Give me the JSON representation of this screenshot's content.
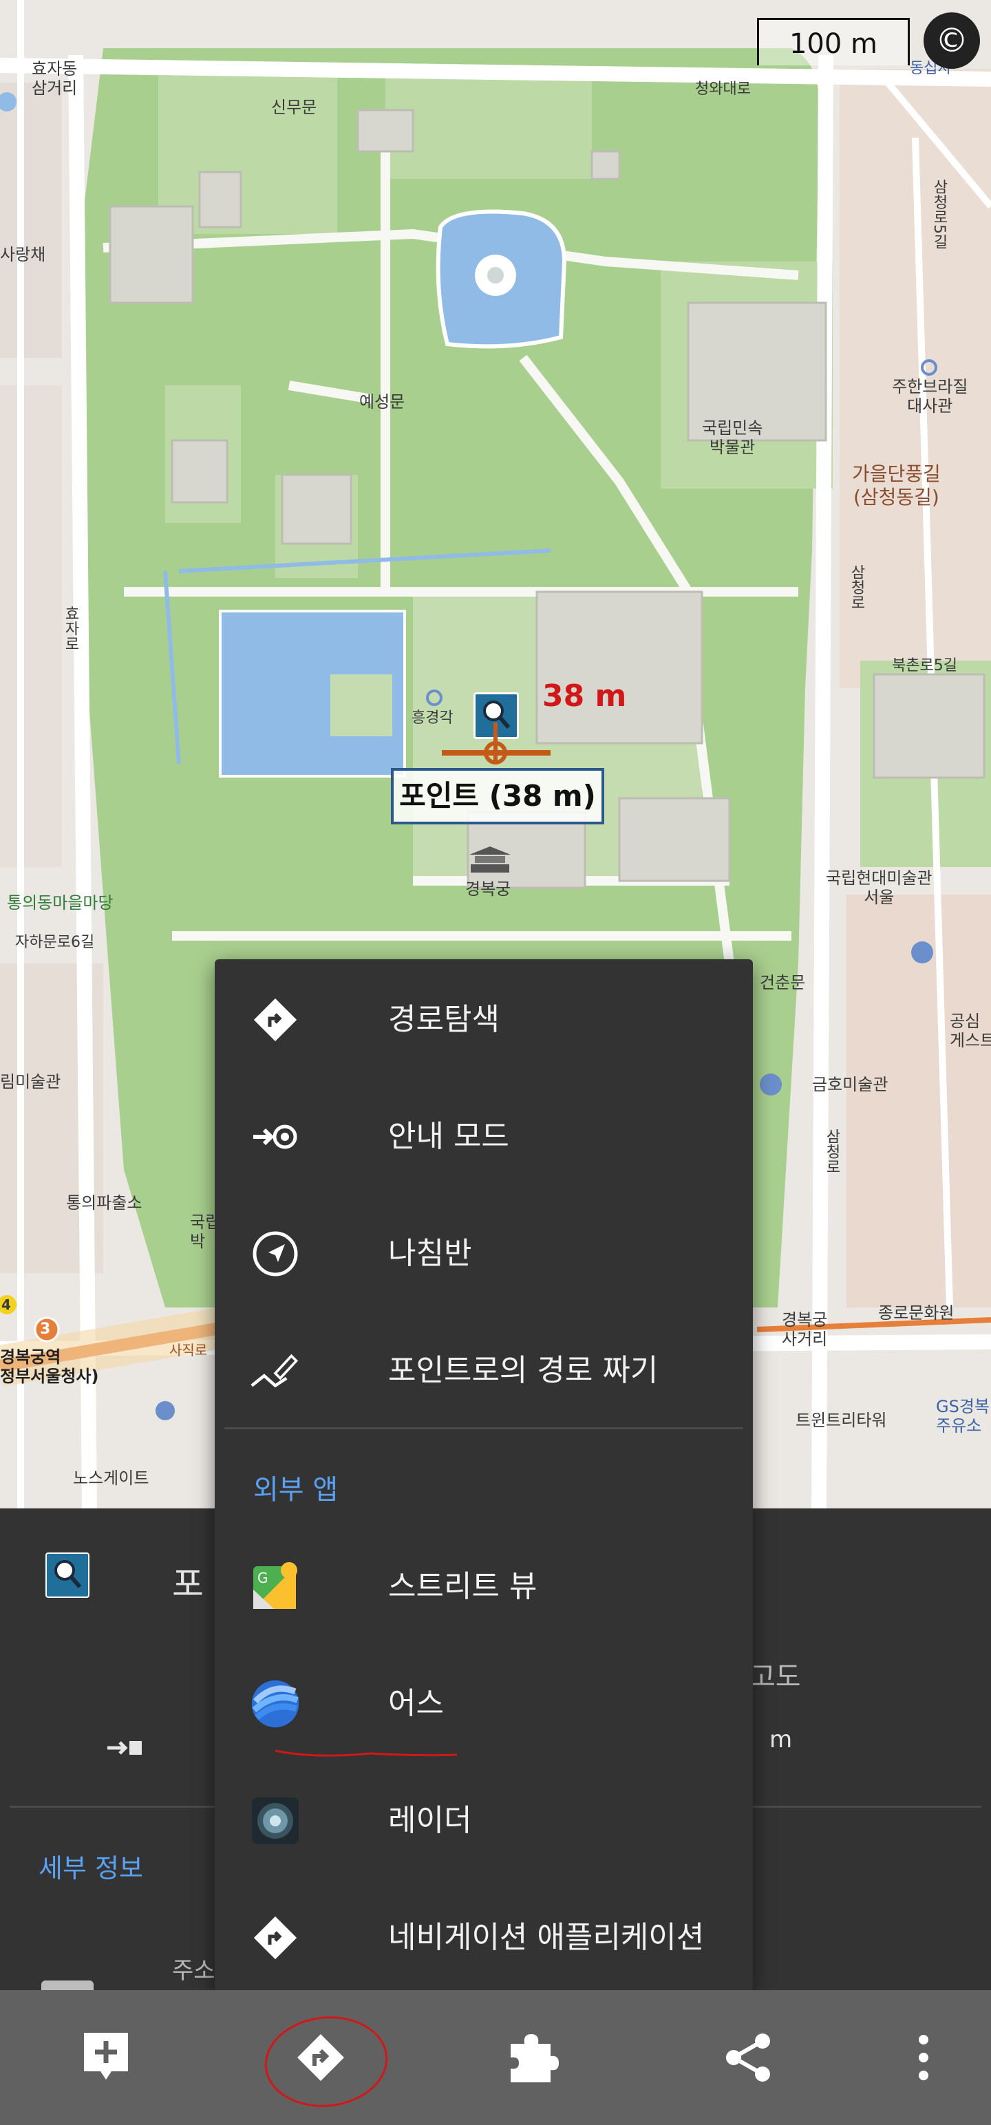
{
  "map": {
    "scale_label": "100 m",
    "copyright_icon": "©",
    "labels": {
      "hyojadong": "효자동\n삼거리",
      "sinmumun": "신무문",
      "cheongwadaero": "청와대로",
      "dongsip": "동십자",
      "samcheongro5gil": "삼청로5길",
      "sarangchae": "사랑채",
      "yeseongmun": "예성문",
      "museum": "국립민속\n박물관",
      "usembassy": "주한브라질\n대사관",
      "autumn": "가을단풍길\n(삼청동길)",
      "samcheongro": "삼청로",
      "bukchonro5gil": "북촌로5길",
      "heunggyeonggak": "흥경각",
      "point_label": "포인트 (38 m)",
      "distance": "38 m",
      "gyeongbokgung": "경복궁",
      "tongui_madang": "통의동마을마당",
      "jahamunro6gil": "자하문로6길",
      "mmca": "국립현대미술관\n서울",
      "geonchunmun": "건춘문",
      "gongsim": "공심\n게스트",
      "geumho": "금호미술관",
      "rimmigwan": "림미술관",
      "tongui_police": "통의파출소",
      "gukrip": "국립\n박",
      "station": "경복궁역\n정부서울청사)",
      "station_num": "3",
      "line_num": "4",
      "sajikro": "사직로",
      "gyeongbok_intersection": "경복궁\n사거리",
      "jongno_center": "종로문화원",
      "twintree": "트윈트리타워",
      "gs": "GS경복\n주유소",
      "nos": "노스게이트",
      "hyojaro": "효자로",
      "samcheongro_v": "삼청로"
    }
  },
  "panel": {
    "title_partial": "포",
    "altitude_label": "고도",
    "altitude_unit": "m",
    "details_label": "세부 정보",
    "address_label": "주소"
  },
  "menu": {
    "items": [
      {
        "label": "경로탐색",
        "icon": "directions-icon"
      },
      {
        "label": "안내 모드",
        "icon": "guidance-icon"
      },
      {
        "label": "나침반",
        "icon": "compass-icon"
      },
      {
        "label": "포인트로의 경로 짜기",
        "icon": "route-plan-icon"
      }
    ],
    "external_header": "외부 앱",
    "external_items": [
      {
        "label": "스트리트 뷰",
        "icon": "street-view-icon"
      },
      {
        "label": "어스",
        "icon": "earth-icon"
      },
      {
        "label": "레이더",
        "icon": "radar-icon"
      },
      {
        "label": "네비게이션 애플리케이션",
        "icon": "navigation-app-icon"
      }
    ]
  },
  "toolbar": {
    "buttons": [
      "add-note",
      "directions",
      "addons",
      "share",
      "more"
    ]
  },
  "colors": {
    "accent_blue": "#5aa1f2",
    "menu_bg": "#333333",
    "toolbar_bg": "#616161",
    "annotation_red": "#d01818",
    "park_green": "#a9cf8e"
  }
}
